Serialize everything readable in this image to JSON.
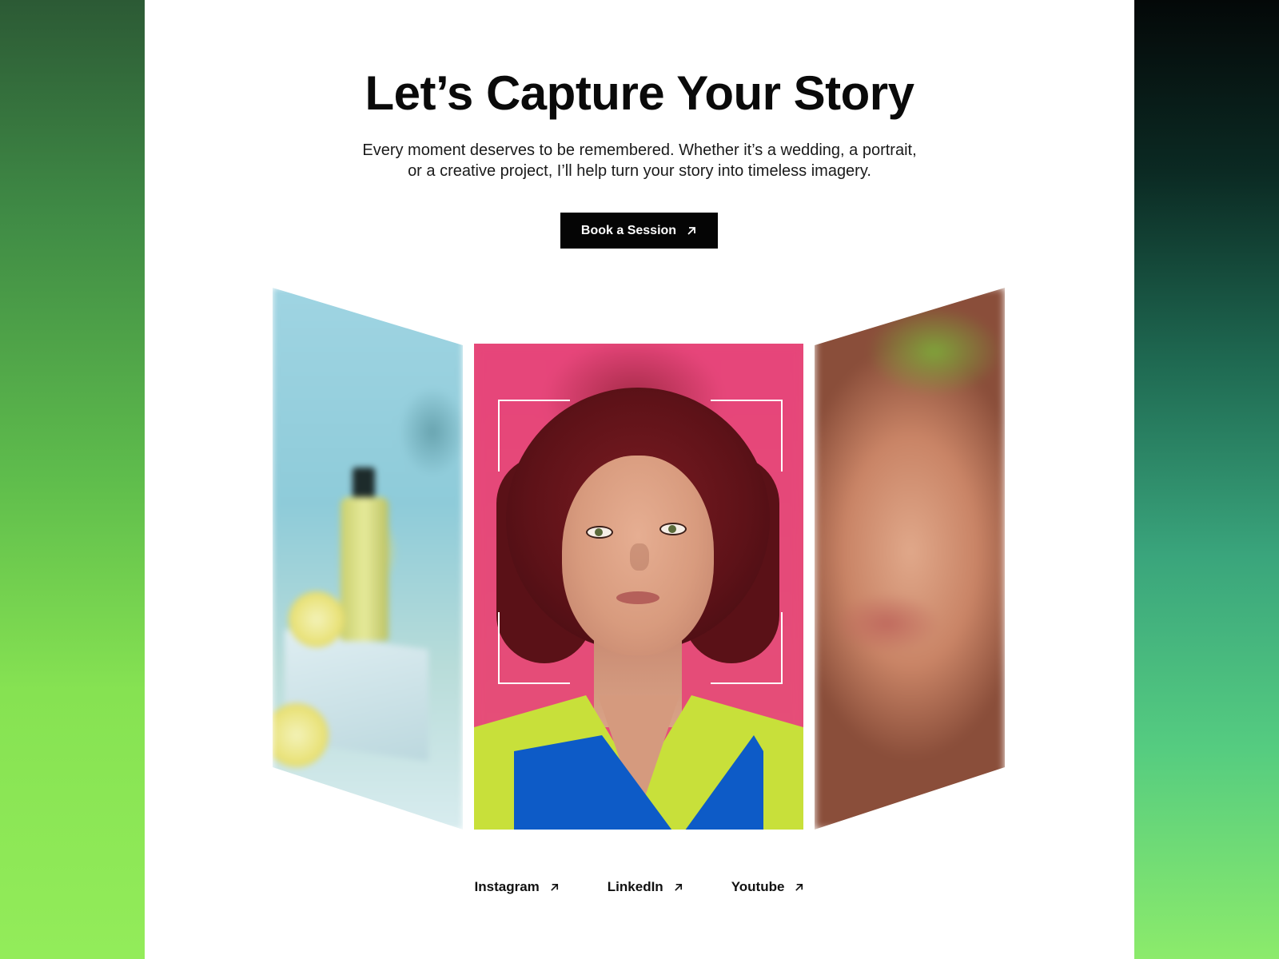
{
  "hero": {
    "title": "Let’s Capture Your Story",
    "subtitle_line1": "Every moment deserves to be remembered. Whether it’s a wedding, a portrait,",
    "subtitle_line2": "or a creative project, I’ll help turn your story into timeless imagery.",
    "cta_label": "Book a Session",
    "cta_icon": "arrow-up-right-icon"
  },
  "gallery": {
    "left_card": "product-photo",
    "center_card": "portrait-photo",
    "right_card": "closeup-portrait-photo"
  },
  "socials": [
    {
      "label": "Instagram",
      "icon": "arrow-up-right-icon"
    },
    {
      "label": "LinkedIn",
      "icon": "arrow-up-right-icon"
    },
    {
      "label": "Youtube",
      "icon": "arrow-up-right-icon"
    }
  ],
  "colors": {
    "accent_green": "#8ceb5a",
    "button_bg": "#050505",
    "portrait_bg": "#e64b78",
    "jacket_lime": "#c8e03a",
    "jacket_blue": "#0d5bc7"
  }
}
